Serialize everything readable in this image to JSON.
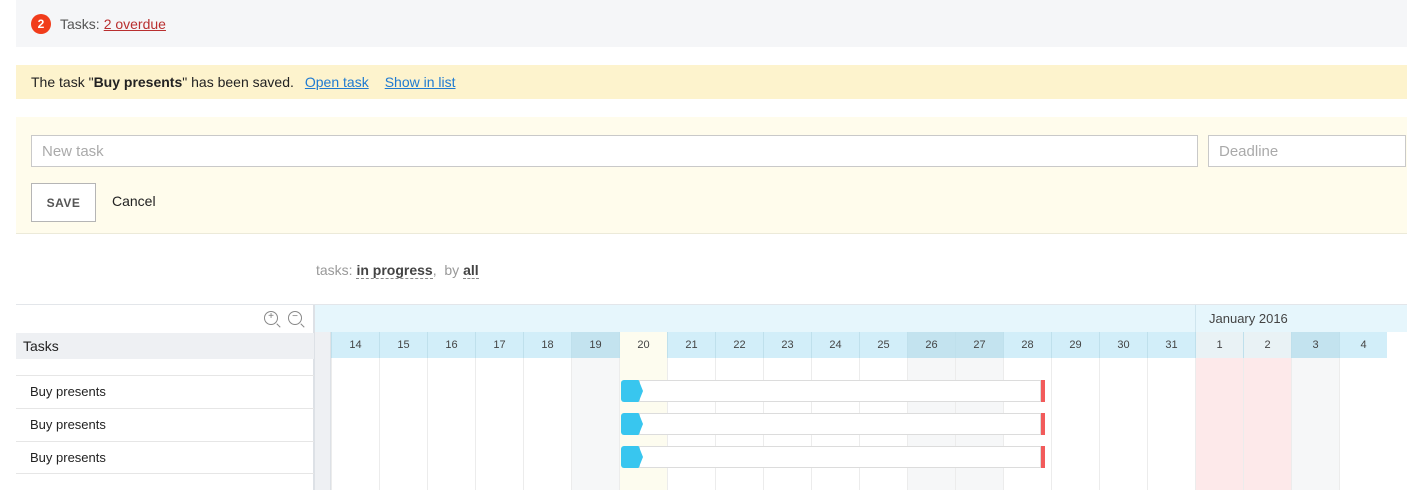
{
  "overdue": {
    "count": "2",
    "label": "Tasks:",
    "link": "2 overdue"
  },
  "notice": {
    "prefix": "The task \"",
    "task_name": "Buy presents",
    "suffix": "\" has been saved.",
    "open_link": "Open task",
    "list_link": "Show in list"
  },
  "form": {
    "task_placeholder": "New task",
    "deadline_placeholder": "Deadline",
    "save_label": "SAVE",
    "cancel_label": "Cancel"
  },
  "filter": {
    "label": "tasks:",
    "status": "in progress",
    "by_label": "by",
    "owner": "all"
  },
  "gantt": {
    "tasks_header": "Tasks",
    "zoom_in_icon": "zoom-in-icon",
    "zoom_out_icon": "zoom-out-icon",
    "month": "January 2016",
    "days": [
      "14",
      "15",
      "16",
      "17",
      "18",
      "19",
      "20",
      "21",
      "22",
      "23",
      "24",
      "25",
      "26",
      "27",
      "28",
      "29",
      "30",
      "31",
      "1",
      "2",
      "3",
      "4"
    ],
    "tasks": [
      "Buy presents",
      "Buy presents",
      "Buy presents"
    ],
    "colors": {
      "bar_head": "#38c6ef",
      "deadline_marker": "#f25b5b",
      "overdue_badge": "#f13c1b"
    }
  }
}
